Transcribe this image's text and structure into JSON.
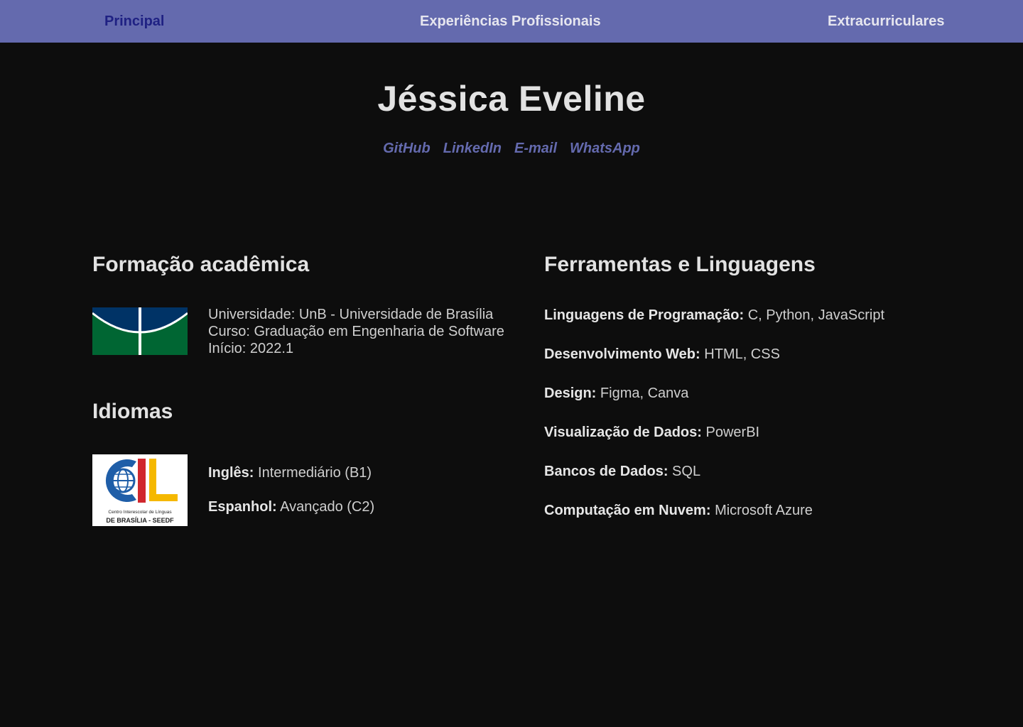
{
  "nav": {
    "items": [
      {
        "label": "Principal",
        "active": true
      },
      {
        "label": "Experiências Profissionais",
        "active": false
      },
      {
        "label": "Extracurriculares",
        "active": false
      }
    ]
  },
  "profile": {
    "name": "Jéssica Eveline",
    "links": [
      {
        "label": "GitHub"
      },
      {
        "label": "LinkedIn"
      },
      {
        "label": "E-mail"
      },
      {
        "label": "WhatsApp"
      }
    ]
  },
  "education": {
    "title": "Formação acadêmica",
    "lines": [
      "Universidade: UnB - Universidade de Brasília",
      "Curso: Graduação em Engenharia de Software",
      "Início: 2022.1"
    ]
  },
  "languages": {
    "title": "Idiomas",
    "logo_text": {
      "line1": "Centro Interescolar de Línguas",
      "line2": "DE BRASÍLIA - SEEDF"
    },
    "items": [
      {
        "label": "Inglês:",
        "value": "Intermediário (B1)"
      },
      {
        "label": "Espanhol:",
        "value": "Avançado (C2)"
      }
    ]
  },
  "tools": {
    "title": "Ferramentas e Linguagens",
    "items": [
      {
        "label": "Linguagens de Programação:",
        "value": "C, Python, JavaScript"
      },
      {
        "label": "Desenvolvimento Web:",
        "value": "HTML, CSS"
      },
      {
        "label": "Design:",
        "value": "Figma, Canva"
      },
      {
        "label": "Visualização de Dados:",
        "value": "PowerBI"
      },
      {
        "label": "Bancos de Dados:",
        "value": "SQL"
      },
      {
        "label": "Computação em Nuvem:",
        "value": "Microsoft Azure"
      }
    ]
  },
  "colors": {
    "navbar": "#646aae",
    "nav_active": "#1f2183",
    "background": "#0d0d0d",
    "link": "#646aae",
    "unb_blue": "#003366",
    "unb_green": "#006633",
    "cil_blue": "#1f5ea8",
    "cil_red": "#d0282e",
    "cil_yellow": "#f5b800"
  },
  "icons": {
    "unb_logo": "unb-flag-logo",
    "cil_logo": "cil-logo"
  }
}
